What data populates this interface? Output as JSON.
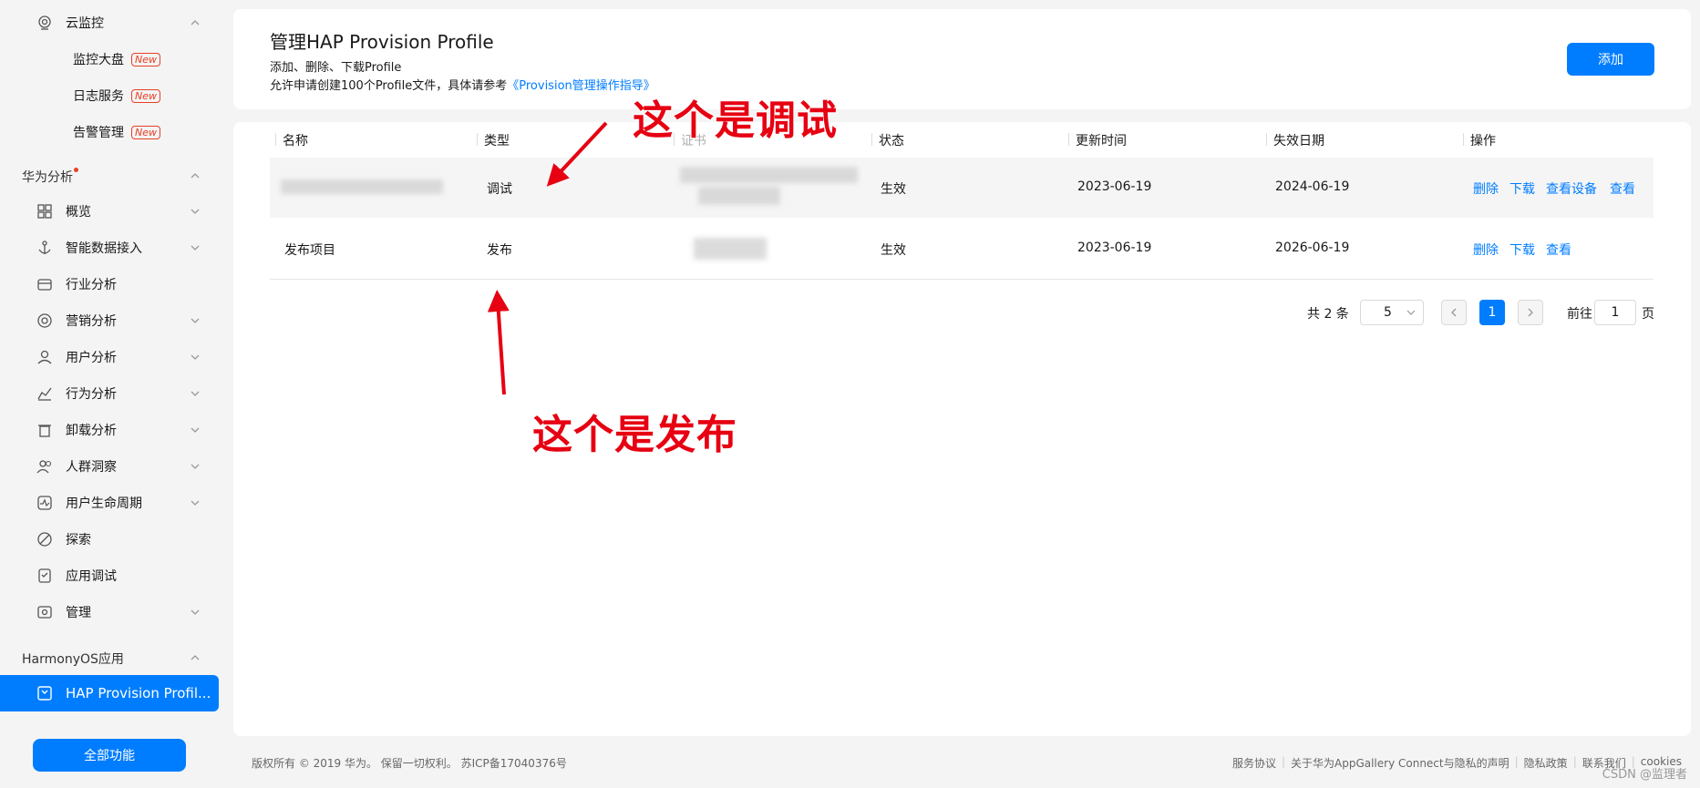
{
  "sidebar": {
    "cloud_monitor": {
      "label": "云监控",
      "icon": "cloud-monitor-icon"
    },
    "cloud_sub": [
      {
        "label": "监控大盘",
        "badge": "New"
      },
      {
        "label": "日志服务",
        "badge": "New"
      },
      {
        "label": "告警管理",
        "badge": "New"
      }
    ],
    "analytics_group": "华为分析",
    "analytics_items": [
      {
        "label": "概览",
        "icon": "grid-icon",
        "chev": true
      },
      {
        "label": "智能数据接入",
        "icon": "anchor-icon",
        "chev": true
      },
      {
        "label": "行业分析",
        "icon": "industry-icon",
        "chev": false
      },
      {
        "label": "营销分析",
        "icon": "target-icon",
        "chev": true
      },
      {
        "label": "用户分析",
        "icon": "user-icon",
        "chev": true
      },
      {
        "label": "行为分析",
        "icon": "behavior-chart-icon",
        "chev": true
      },
      {
        "label": "卸载分析",
        "icon": "trash-icon",
        "chev": true
      },
      {
        "label": "人群洞察",
        "icon": "people-icon",
        "chev": true
      },
      {
        "label": "用户生命周期",
        "icon": "lifecycle-icon",
        "chev": true
      },
      {
        "label": "探索",
        "icon": "explore-icon",
        "chev": false
      },
      {
        "label": "应用调试",
        "icon": "debug-icon",
        "chev": false
      },
      {
        "label": "管理",
        "icon": "manage-icon",
        "chev": true
      }
    ],
    "harmony_group": "HarmonyOS应用",
    "active_item": "HAP Provision Profil...",
    "all_functions": "全部功能"
  },
  "header": {
    "title": "管理HAP Provision Profile",
    "subtitle1": "添加、删除、下载Profile",
    "subtitle2_prefix": "允许申请创建100个Profile文件，具体请参考",
    "subtitle2_link": "《Provision管理操作指导》",
    "add_button": "添加"
  },
  "table": {
    "columns": [
      "名称",
      "类型",
      "证书",
      "状态",
      "更新时间",
      "失效日期",
      "操作"
    ],
    "rows": [
      {
        "name": "",
        "type": "调试",
        "status": "生效",
        "updated": "2023-06-19",
        "expires": "2024-06-19",
        "actions": [
          "删除",
          "下载",
          "查看设备",
          "查看"
        ]
      },
      {
        "name": "发布项目",
        "type": "发布",
        "status": "生效",
        "updated": "2023-06-19",
        "expires": "2026-06-19",
        "actions": [
          "删除",
          "下载",
          "查看"
        ]
      }
    ]
  },
  "pagination": {
    "total": "共 2 条",
    "page_size": "5",
    "current_page": "1",
    "goto_label": "前往",
    "goto_value": "1",
    "page_suffix": "页"
  },
  "annotations": {
    "debug_note": "这个是调试",
    "release_note": "这个是发布"
  },
  "footer": {
    "copyright": "版权所有 © 2019 华为。 保留一切权利。 苏ICP备17040376号",
    "links": [
      "服务协议",
      "关于华为AppGallery Connect与隐私的声明",
      "隐私政策",
      "联系我们",
      "cookies"
    ],
    "watermark": "CSDN @监理者"
  },
  "colors": {
    "accent": "#007dff",
    "annotation": "#e60012",
    "badge": "#e84026"
  }
}
